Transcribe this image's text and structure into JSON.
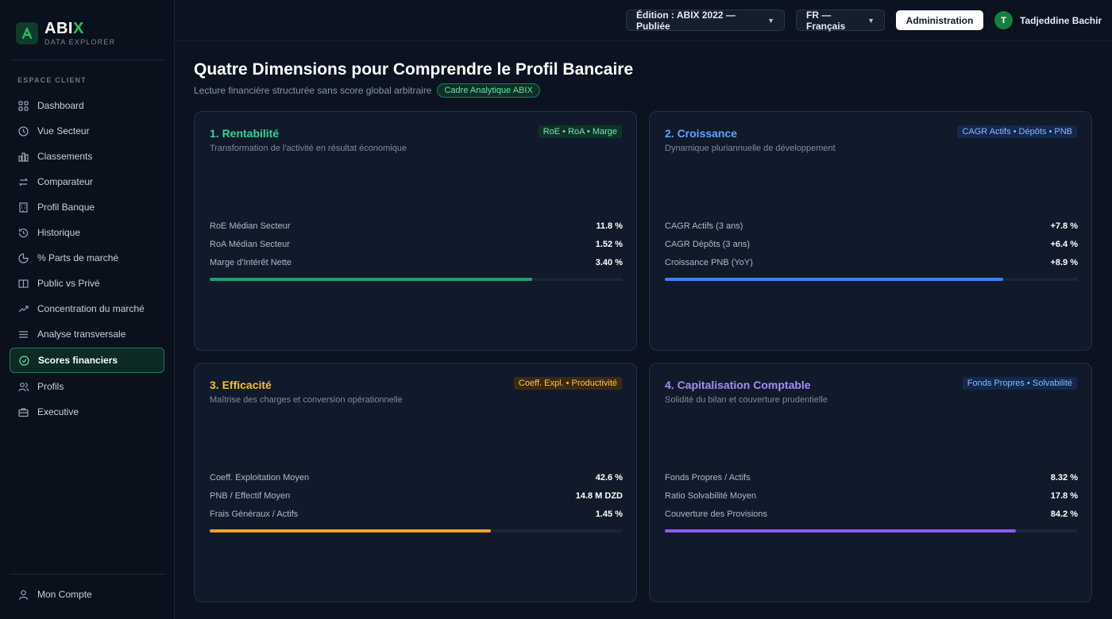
{
  "brand": {
    "name_main": "ABI",
    "name_accent": "X",
    "subtitle": "DATA EXPLORER"
  },
  "sidebar": {
    "section": "ESPACE CLIENT",
    "items": [
      {
        "label": "Dashboard",
        "icon": "grid-icon"
      },
      {
        "label": "Vue Secteur",
        "icon": "clock-icon"
      },
      {
        "label": "Classements",
        "icon": "bar-chart-icon"
      },
      {
        "label": "Comparateur",
        "icon": "swap-icon"
      },
      {
        "label": "Profil Banque",
        "icon": "building-icon"
      },
      {
        "label": "Historique",
        "icon": "history-icon"
      },
      {
        "label": "% Parts de marché",
        "icon": "pie-icon"
      },
      {
        "label": "Public vs Privé",
        "icon": "columns-icon"
      },
      {
        "label": "Concentration du marché",
        "icon": "trend-icon"
      },
      {
        "label": "Analyse transversale",
        "icon": "list-icon"
      },
      {
        "label": "Scores financiers",
        "icon": "check-circle-icon",
        "active": true
      },
      {
        "label": "Profils",
        "icon": "users-icon"
      },
      {
        "label": "Executive",
        "icon": "briefcase-icon"
      }
    ],
    "account": "Mon Compte"
  },
  "topbar": {
    "edition": "Édition : ABIX 2022 — Publiée",
    "language": "FR — Français",
    "admin": "Administration",
    "user_initial": "T",
    "user_name": "Tadjeddine Bachir"
  },
  "main": {
    "title": "Quatre Dimensions pour Comprendre le Profil Bancaire",
    "subtitle": "Lecture financière structurée sans score global arbitraire",
    "badge": "Cadre Analytique ABIX",
    "cards": [
      {
        "title": "1. Rentabilité",
        "desc": "Transformation de l'activité en résultat économique",
        "tag": "RoE • RoA • Marge",
        "color": "#34d399",
        "tag_bg": "#0f3329",
        "tag_fg": "#6ee7b7",
        "bar_color": "#22a06b",
        "progress": 0.78,
        "metrics": [
          {
            "label": "RoE Médian Secteur",
            "value": "11.8 %"
          },
          {
            "label": "RoA Médian Secteur",
            "value": "1.52 %"
          },
          {
            "label": "Marge d'Intérêt Nette",
            "value": "3.40 %"
          }
        ]
      },
      {
        "title": "2. Croissance",
        "desc": "Dynamique pluriannuelle de développement",
        "tag": "CAGR Actifs • Dépôts • PNB",
        "color": "#60a5fa",
        "tag_bg": "#13284a",
        "tag_fg": "#8ab8ff",
        "bar_color": "#3b82f6",
        "progress": 0.82,
        "metrics": [
          {
            "label": "CAGR Actifs (3 ans)",
            "value": "+7.8 %"
          },
          {
            "label": "CAGR Dépôts (3 ans)",
            "value": "+6.4 %"
          },
          {
            "label": "Croissance PNB (YoY)",
            "value": "+8.9 %"
          }
        ]
      },
      {
        "title": "3. Efficacité",
        "desc": "Maîtrise des charges et conversion opérationnelle",
        "tag": "Coeff. Expl. • Productivité",
        "color": "#fbbf24",
        "tag_bg": "#3a2a10",
        "tag_fg": "#fcc552",
        "bar_color": "#f5a524",
        "progress": 0.68,
        "metrics": [
          {
            "label": "Coeff. Exploitation Moyen",
            "value": "42.6 %"
          },
          {
            "label": "PNB / Effectif Moyen",
            "value": "14.8 M DZD"
          },
          {
            "label": "Frais Généraux / Actifs",
            "value": "1.45 %"
          }
        ]
      },
      {
        "title": "4. Capitalisation Comptable",
        "desc": "Solidité du bilan et couverture prudentielle",
        "tag": "Fonds Propres • Solvabilité",
        "color": "#a78bfa",
        "tag_bg": "#13284a",
        "tag_fg": "#8ab8ff",
        "bar_color": "#8b5cf6",
        "progress": 0.85,
        "metrics": [
          {
            "label": "Fonds Propres / Actifs",
            "value": "8.32 %"
          },
          {
            "label": "Ratio Solvabilité Moyen",
            "value": "17.8 %"
          },
          {
            "label": "Couverture des Provisions",
            "value": "84.2 %"
          }
        ]
      }
    ]
  }
}
